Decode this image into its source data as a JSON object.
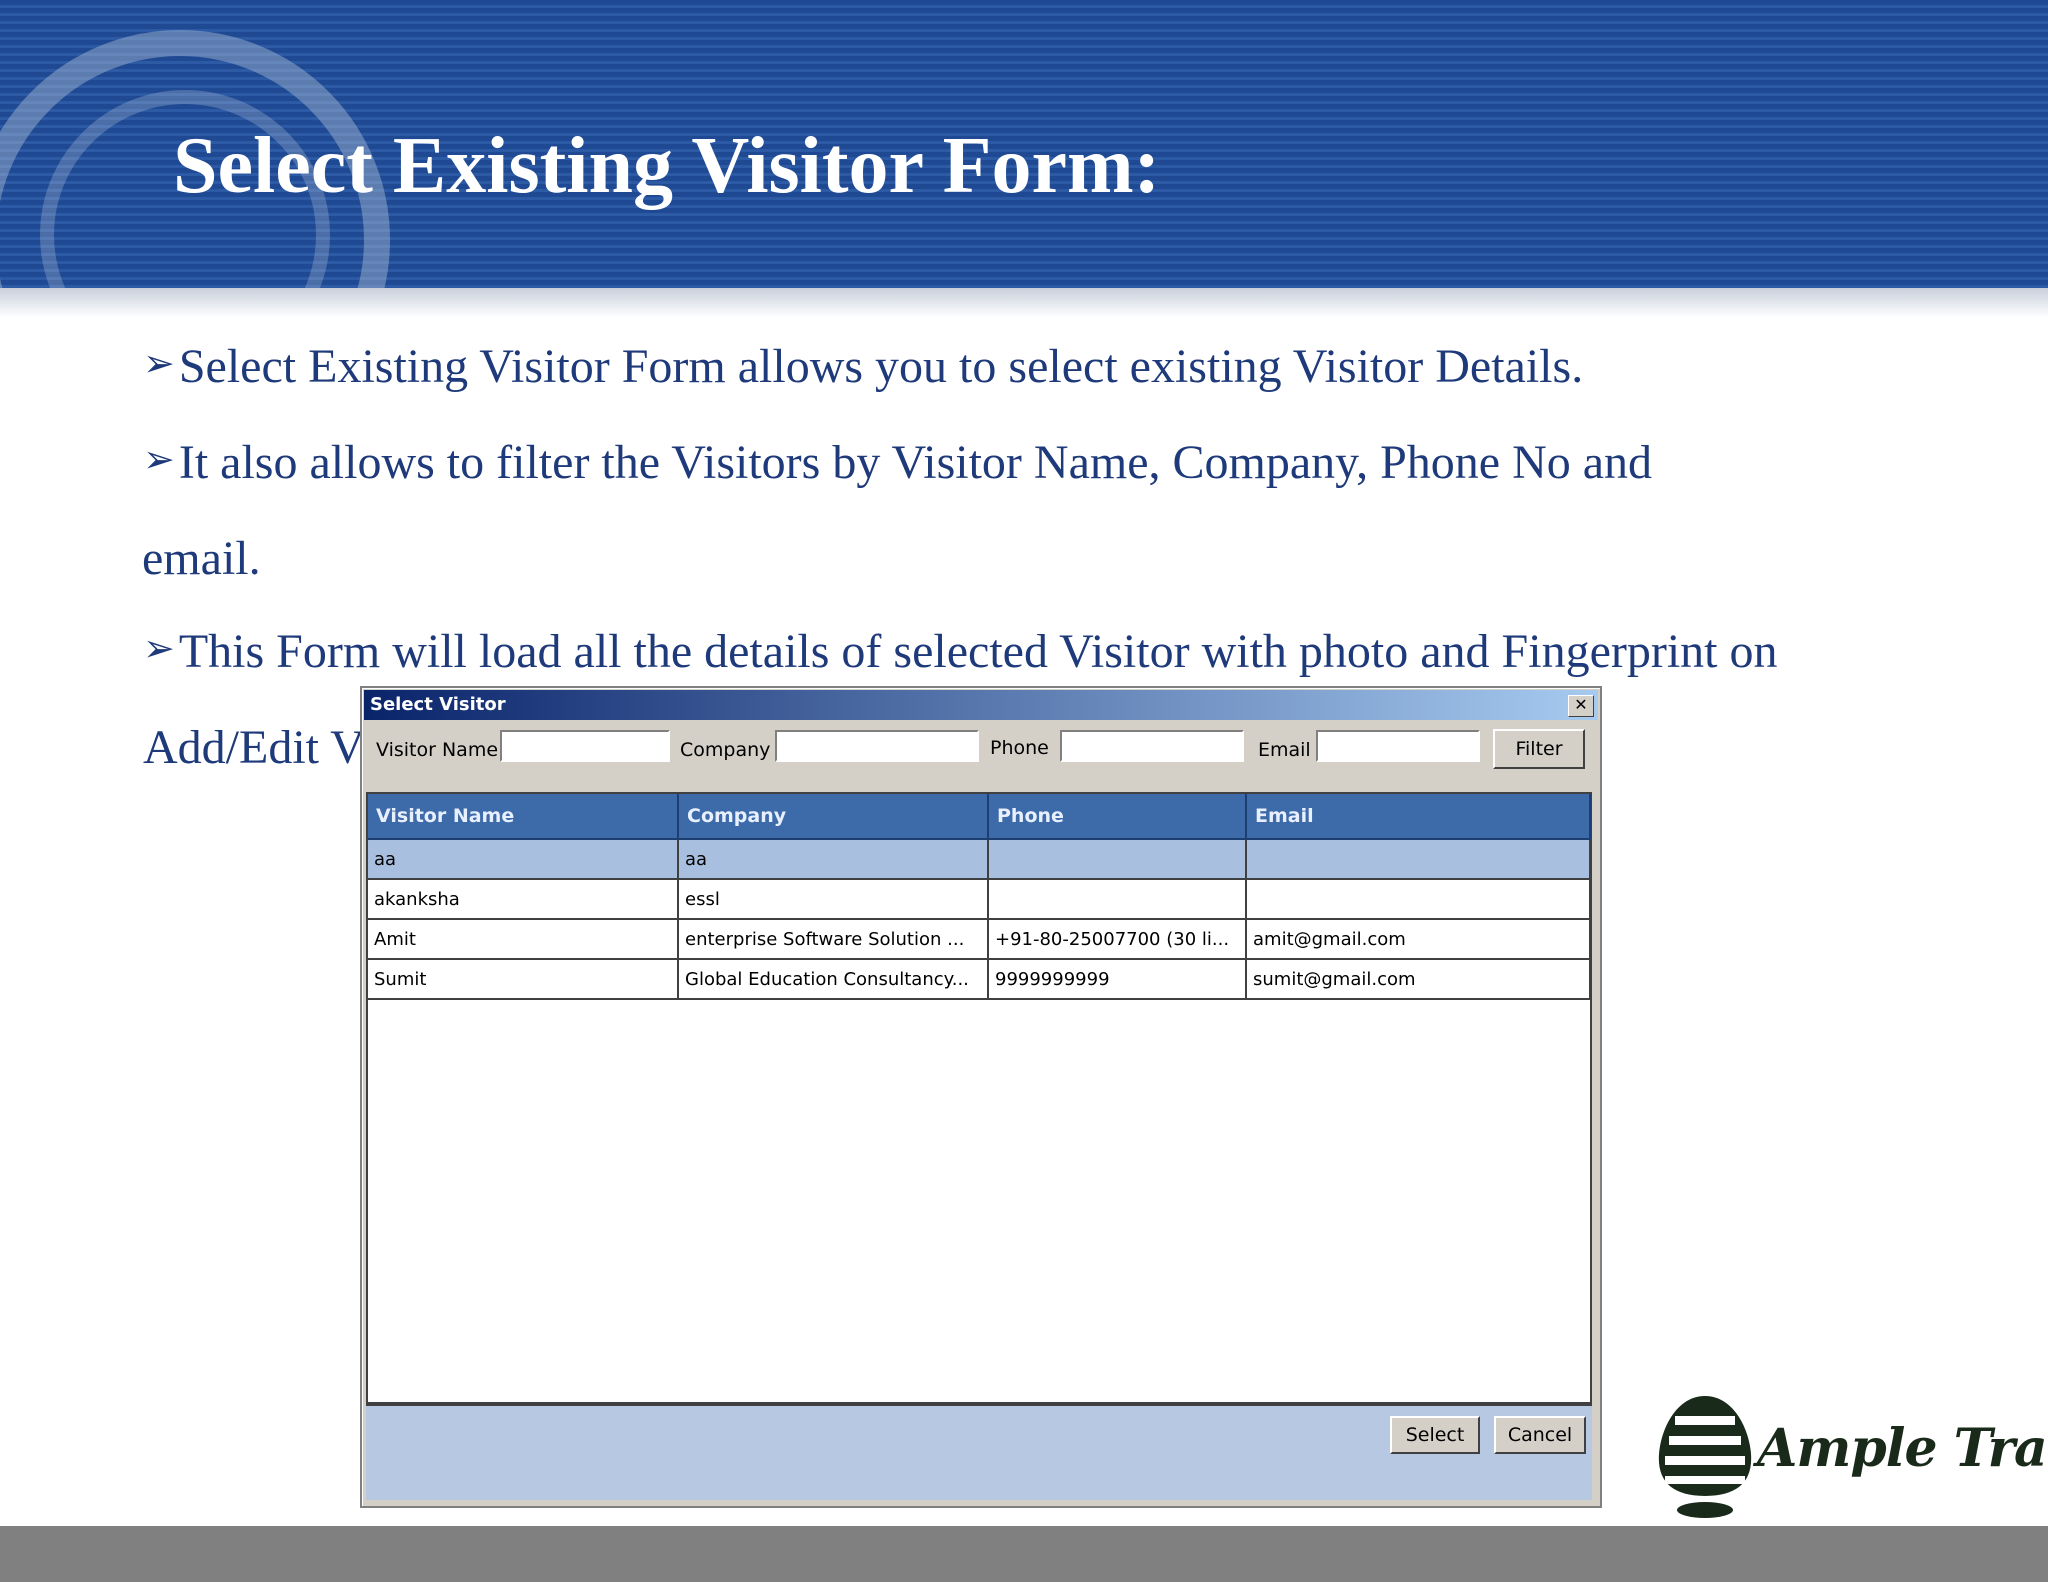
{
  "slide": {
    "title": "Select Existing Visitor Form:",
    "bullets": [
      "Select Existing Visitor Form allows you to select existing Visitor Details.",
      "It also allows to filter the Visitors by Visitor Name, Company, Phone No and",
      "This Form will load all the details of selected Visitor with photo and Fingerprint on"
    ],
    "bullet_continuations": [
      "email.",
      "Add/Edit V"
    ],
    "bullet_arrow": "➢"
  },
  "dialog": {
    "title": "Select Visitor",
    "close_glyph": "✕",
    "filters": {
      "visitor_name_label": "Visitor Name",
      "visitor_name_value": "",
      "company_label": "Company",
      "company_value": "",
      "phone_label": "Phone",
      "phone_value": "",
      "email_label": "Email",
      "email_value": "",
      "filter_button": "Filter"
    },
    "columns": [
      "Visitor Name",
      "Company",
      "Phone",
      "Email"
    ],
    "rows": [
      [
        "aa",
        "aa",
        "",
        ""
      ],
      [
        "akanksha",
        "essl",
        "",
        ""
      ],
      [
        "Amit",
        "enterprise Software Solution ...",
        "+91-80-25007700 (30 li...",
        "amit@gmail.com"
      ],
      [
        "Sumit",
        "Global Education Consultancy...",
        "9999999999",
        "sumit@gmail.com"
      ]
    ],
    "selected_row": 0,
    "select_button": "Select",
    "cancel_button": "Cancel"
  },
  "logo": {
    "text": "Ample Trails",
    "icon": "ample-trails-logo-icon",
    "colors": {
      "dark": "#1a2a1a"
    }
  },
  "colors": {
    "header_blue": "#1f4a93",
    "bullet_text": "#1e3a7a",
    "grid_header": "#3d6aa8",
    "selected_row": "#a9bfdf",
    "bottom_band": "#808080"
  }
}
